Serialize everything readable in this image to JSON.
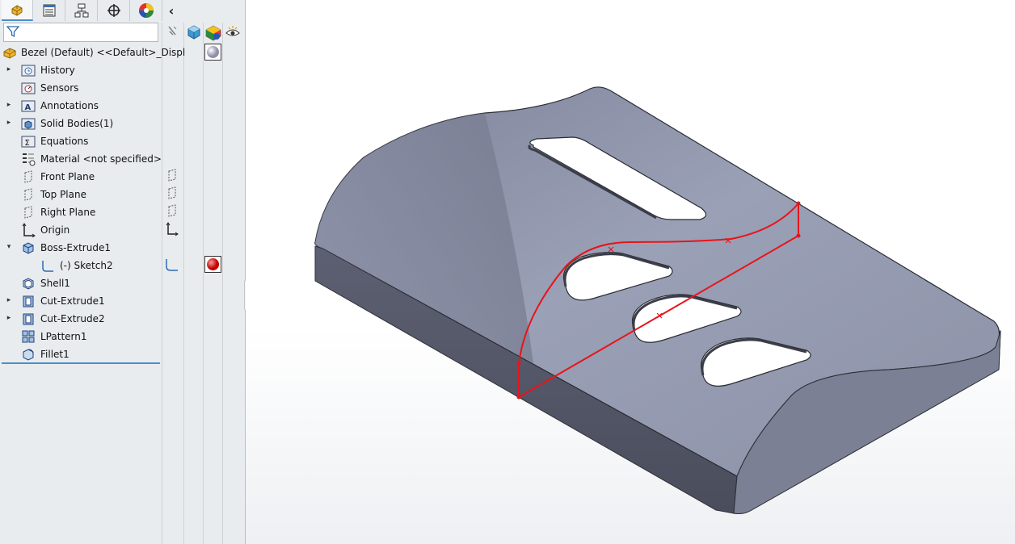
{
  "tabs": [
    {
      "name": "feature-manager",
      "icon": "feature-manager-icon"
    },
    {
      "name": "property-manager",
      "icon": "property-manager-icon"
    },
    {
      "name": "configuration-manager",
      "icon": "configuration-manager-icon"
    },
    {
      "name": "dimxpert-manager",
      "icon": "dimxpert-icon"
    },
    {
      "name": "display-manager",
      "icon": "display-manager-icon"
    }
  ],
  "collapse_label": "‹",
  "filter": {
    "placeholder": "",
    "value": ""
  },
  "tree": {
    "root": "Bezel (Default) <<Default>_Displ",
    "items": [
      {
        "label": "History",
        "icon": "history-folder-icon",
        "expand": true
      },
      {
        "label": "Sensors",
        "icon": "sensors-folder-icon",
        "expand": false
      },
      {
        "label": "Annotations",
        "icon": "annotations-folder-icon",
        "expand": true
      },
      {
        "label": "Solid Bodies(1)",
        "icon": "solid-bodies-folder-icon",
        "expand": true
      },
      {
        "label": "Equations",
        "icon": "equations-folder-icon",
        "expand": false
      },
      {
        "label": "Material <not specified>",
        "icon": "material-icon",
        "expand": false
      },
      {
        "label": "Front Plane",
        "icon": "plane-icon",
        "expand": false
      },
      {
        "label": "Top Plane",
        "icon": "plane-icon",
        "expand": false
      },
      {
        "label": "Right Plane",
        "icon": "plane-icon",
        "expand": false
      },
      {
        "label": "Origin",
        "icon": "origin-icon",
        "expand": false
      },
      {
        "label": "Boss-Extrude1",
        "icon": "boss-extrude-icon",
        "expand": true,
        "expanded": true
      },
      {
        "label": "(-) Sketch2",
        "icon": "sketch-icon",
        "expand": false,
        "child": true
      },
      {
        "label": "Shell1",
        "icon": "shell-icon",
        "expand": false
      },
      {
        "label": "Cut-Extrude1",
        "icon": "cut-extrude-icon",
        "expand": true
      },
      {
        "label": "Cut-Extrude2",
        "icon": "cut-extrude-icon",
        "expand": true
      },
      {
        "label": "LPattern1",
        "icon": "linear-pattern-icon",
        "expand": false
      },
      {
        "label": "Fillet1",
        "icon": "fillet-icon",
        "expand": false
      }
    ]
  },
  "colors": {
    "accent": "#4a8ec9",
    "sketch": "#e8141a",
    "body": "#8a8fa3"
  }
}
